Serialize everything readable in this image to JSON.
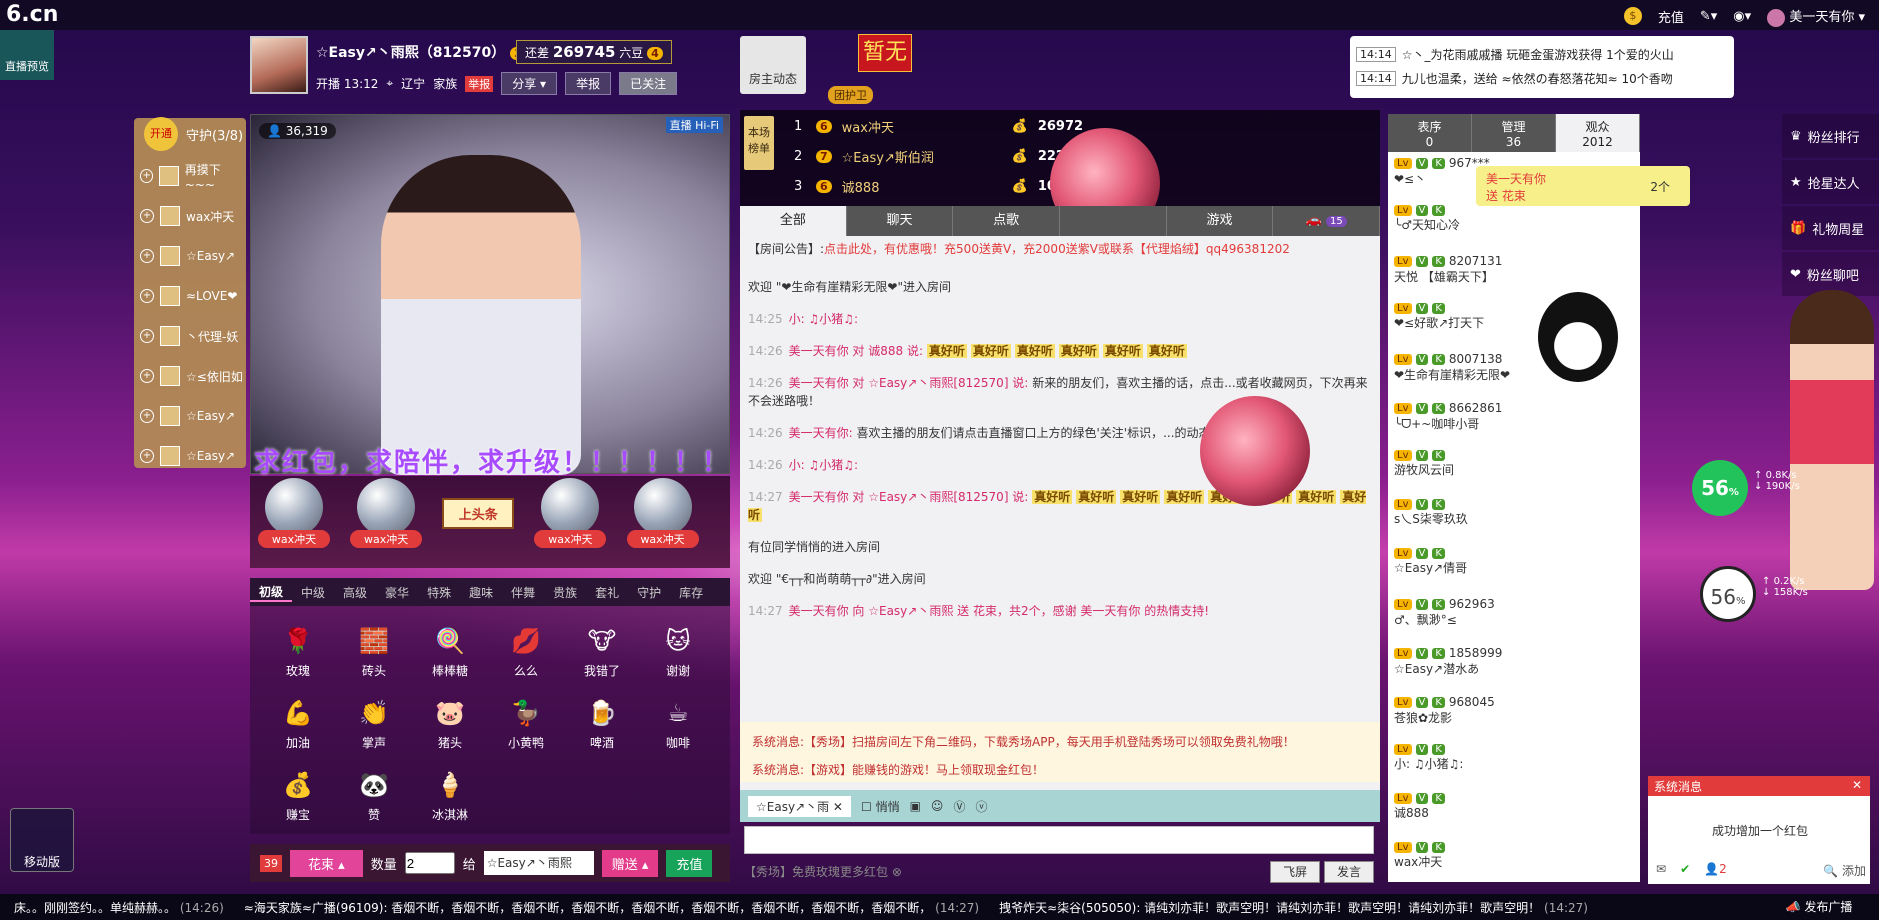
{
  "top": {
    "logo": "6.cn",
    "recharge": "充值",
    "username": "美一天有你"
  },
  "side": {
    "live_preview": "直播预览",
    "mobile": "移动版"
  },
  "host": {
    "name": "☆Easy↗丶雨熙（812570）",
    "level": "3",
    "gap_label": "还差",
    "gap_value": "269745",
    "gap_unit": "六豆",
    "next_level": "4",
    "start": "开播 13:12",
    "location": "辽宁",
    "family": "家族",
    "report_tag": "举报",
    "share": "分享",
    "report": "举报",
    "followed": "已关注",
    "host_dynamic": "房主动态",
    "flag": "暂无",
    "guard_tag": "团护卫"
  },
  "broadcast": [
    {
      "time": "14:14",
      "text": "☆丶_为花雨戚戚播 玩砸金蛋游戏获得 1个爱的火山"
    },
    {
      "time": "14:14",
      "text": "九儿也温柔，送给 ≈依然の春怒落花知≈ 10个香吻"
    }
  ],
  "guard": {
    "open": "开通",
    "title": "守护(3/8)",
    "items": [
      "再摸下~~~",
      "wax冲天",
      "☆Easy↗",
      "≈LOVE❤",
      "丶代理-妖",
      "☆≤依旧如",
      "☆Easy↗",
      "☆Easy↗"
    ]
  },
  "video": {
    "viewers": "36,319",
    "tag_live": "直播",
    "tag_hd": "Hi-Fi",
    "banner": "求红包，求陪伴，求升级！！！！！！"
  },
  "globes": [
    "wax冲天",
    "wax冲天",
    "wax冲天",
    "wax冲天"
  ],
  "headline": "上头条",
  "gift_tabs": [
    "初级",
    "中级",
    "高级",
    "豪华",
    "特殊",
    "趣味",
    "伴舞",
    "贵族",
    "套礼",
    "守护",
    "库存"
  ],
  "gifts": [
    {
      "name": "玫瑰",
      "icon": "🌹"
    },
    {
      "name": "砖头",
      "icon": "🧱"
    },
    {
      "name": "棒棒糖",
      "icon": "🍭"
    },
    {
      "name": "么么",
      "icon": "💋"
    },
    {
      "name": "我错了",
      "icon": "🐮"
    },
    {
      "name": "谢谢",
      "icon": "🐱"
    },
    {
      "name": "加油",
      "icon": "💪"
    },
    {
      "name": "掌声",
      "icon": "👏"
    },
    {
      "name": "猪头",
      "icon": "🐷"
    },
    {
      "name": "小黄鸭",
      "icon": "🦆"
    },
    {
      "name": "啤酒",
      "icon": "🍺"
    },
    {
      "name": "咖啡",
      "icon": "☕"
    },
    {
      "name": "赚宝",
      "icon": "💰"
    },
    {
      "name": "赞",
      "icon": "🐼"
    },
    {
      "name": "冰淇淋",
      "icon": "🍦"
    }
  ],
  "send": {
    "badge": "39",
    "gift": "花束",
    "qty_label": "数量",
    "qty": "2",
    "to_label": "给",
    "to": "☆Easy↗丶雨熙",
    "send": "赠送",
    "recharge": "充值"
  },
  "rank": {
    "label": "本场榜单",
    "rows": [
      {
        "num": "1",
        "level": "6",
        "name": "wax冲天",
        "value": "26972"
      },
      {
        "num": "2",
        "level": "7",
        "name": "☆Easy↗斯伯润",
        "value": "22222"
      },
      {
        "num": "3",
        "level": "6",
        "name": "诚888",
        "value": "10000"
      }
    ]
  },
  "chat_tabs": [
    "全部",
    "聊天",
    "点歌",
    "",
    "游戏",
    "15"
  ],
  "chat": {
    "notice_label": "【房间公告】:",
    "notice": "点击此处，有优惠哦！充500送黄V，充2000送紫V或联系【代理焰绒】qq496381202",
    "welcome1": "欢迎 \"❤生命有崖精彩无限❤\"进入房间",
    "messages": [
      {
        "time": "14:25",
        "user": "小: ♫小猪♫:",
        "text": "",
        "hl": []
      },
      {
        "time": "14:26",
        "user": "美一天有你 对 诚888 说:",
        "text": "",
        "hl": [
          "真好听",
          "真好听",
          "真好听",
          "真好听",
          "真好听",
          "真好听"
        ]
      },
      {
        "time": "14:26",
        "user": "美一天有你 对 ☆Easy↗丶雨熙[812570] 说:",
        "text": "新来的朋友们，喜欢主播的话，点击...或者收藏网页，下次再来不会迷路哦！",
        "hl": []
      },
      {
        "time": "14:26",
        "user": "美一天有你:",
        "text": "喜欢主播的朋友们请点击直播窗口上方的绿色'关注'标识，...的动态哦！",
        "hl": []
      },
      {
        "time": "14:26",
        "user": "小: ♫小猪♫:",
        "text": "",
        "hl": []
      },
      {
        "time": "14:27",
        "user": "美一天有你 对 ☆Easy↗丶雨熙[812570] 说:",
        "text": "",
        "hl": [
          "真好听",
          "真好听",
          "真好听",
          "真好听",
          "真好听",
          "真好听",
          "真好听",
          "真好听"
        ]
      }
    ],
    "system1": "有位同学悄悄的进入房间",
    "welcome2": "欢迎 \"€┬┬和尚萌萌┬┬∂\"进入房间",
    "last_time": "14:27",
    "last": "美一天有你 向 ☆Easy↗丶雨熙 送 花束，共2个，感谢 美一天有你 的热情支持!"
  },
  "sys_msgs": [
    "系统消息:【秀场】扫描房间左下角二维码，下载秀场APP，每天用手机登陆秀场可以领取免费礼物哦！",
    "系统消息:【游戏】能赚钱的游戏！马上领取现金红包！"
  ],
  "input": {
    "target": "☆Easy↗丶雨",
    "quiet": "悄悄"
  },
  "bottom_chat": {
    "promo": "【秀场】免费玫瑰更多红包",
    "fullscreen": "飞屏",
    "send": "发言"
  },
  "user_tabs": [
    {
      "label": "表序",
      "count": "0"
    },
    {
      "label": "管理",
      "count": "36"
    },
    {
      "label": "观众",
      "count": "2012"
    }
  ],
  "users": [
    {
      "id": "967***",
      "name": "❤≤丶"
    },
    {
      "id": "",
      "name": "╰♂天知心冷"
    },
    {
      "id": "8207131",
      "name": "天悦 【雄霸天下】"
    },
    {
      "id": "",
      "name": "❤≤好歌↗打天下"
    },
    {
      "id": "8007138",
      "name": "❤生命有崖精彩无限❤"
    },
    {
      "id": "8662861",
      "name": "╰ᗜ+~咖啡小哥"
    },
    {
      "id": "",
      "name": "游牧风云间"
    },
    {
      "id": "",
      "name": "s乀S柒零玖玖"
    },
    {
      "id": "",
      "name": "☆Easy↗倩哥"
    },
    {
      "id": "962963",
      "name": "♂、飘渺°≤"
    },
    {
      "id": "1858999",
      "name": "☆Easy↗潜水あ"
    },
    {
      "id": "968045",
      "name": "苍狼✿龙影"
    },
    {
      "id": "",
      "name": "小: ♫小猪♫:"
    },
    {
      "id": "",
      "name": "诚888"
    },
    {
      "id": "",
      "name": "wax冲天"
    }
  ],
  "popup": {
    "user": "美一天有你",
    "text": "送 花束",
    "count": "2个"
  },
  "fan_menu": [
    "粉丝排行",
    "抢星达人",
    "礼物周星",
    "粉丝聊吧"
  ],
  "speed1": {
    "pct": "56",
    "up": "0.8K/s",
    "down": "190K/s"
  },
  "speed2": {
    "pct": "56",
    "up": "0.2K/s",
    "down": "158K/s"
  },
  "sysmsg_box": {
    "title": "系统消息",
    "body": "成功增加一个红包",
    "count": "2",
    "add": "添加"
  },
  "ticker": [
    {
      "text": "床。。刚刚签约。。单纯赫赫。。",
      "time": "(14:26)"
    },
    {
      "text": "≈海天家族≈广播(96109): 香烟不断，香烟不断，香烟不断，香烟不断，香烟不断，香烟不断，香烟不断，香烟不断，香烟不断，",
      "time": "(14:27)"
    },
    {
      "text": "拽爷炸天≈柒谷(505050): 请纯刘亦菲！歌声空明！请纯刘亦菲！歌声空明！请纯刘亦菲！歌声空明！",
      "time": "(14:27)"
    }
  ],
  "ticker_btn": "发布广播"
}
